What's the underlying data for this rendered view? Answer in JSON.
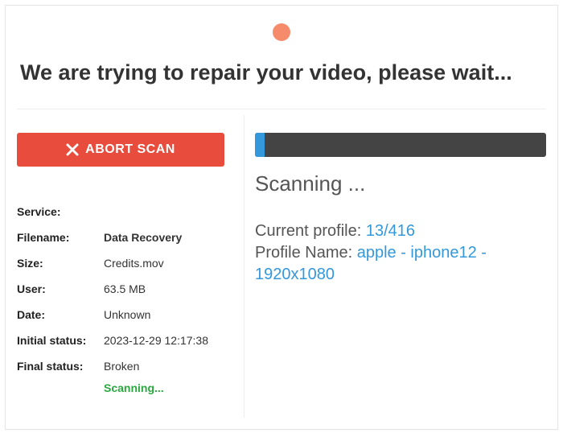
{
  "title": "We are trying to repair your video, please wait...",
  "abort_label": "ABORT SCAN",
  "meta": {
    "service_label": "Service:",
    "service_value": "Data Recovery",
    "filename_label": "Filename:",
    "filename_value": "Credits.mov",
    "size_label": "Size:",
    "size_value": "63.5 MB",
    "user_label": "User:",
    "user_value": "Unknown",
    "date_label": "Date:",
    "date_value": "2023-12-29 12:17:38",
    "initial_status_label": "Initial status:",
    "initial_status_value": "Broken",
    "final_status_label": "Final status:",
    "final_status_value": "Scanning..."
  },
  "scan": {
    "heading": "Scanning ...",
    "current_profile_label": "Current profile: ",
    "current_profile_value": "13/416",
    "profile_name_label": "Profile Name: ",
    "profile_name_value": "apple - iphone12 - 1920x1080"
  }
}
